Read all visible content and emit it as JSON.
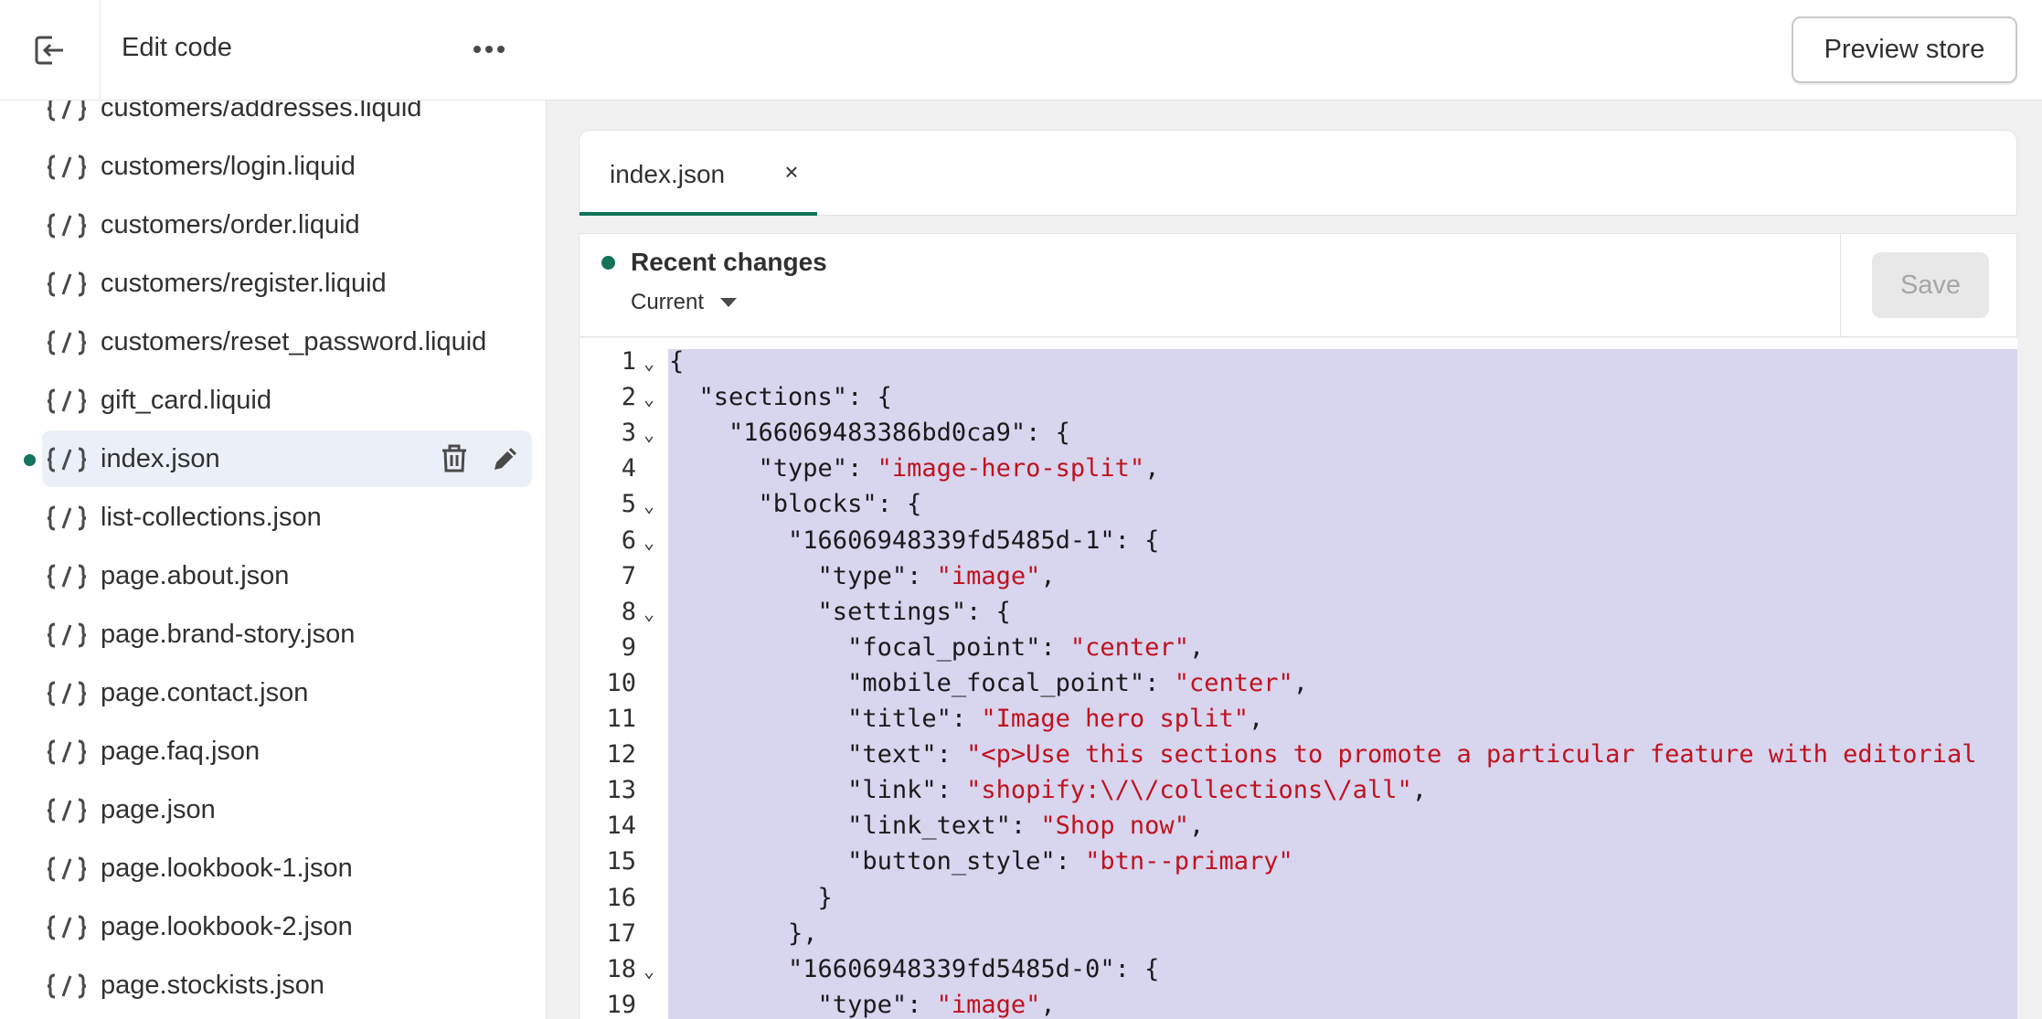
{
  "header": {
    "title": "Edit code",
    "preview_label": "Preview store",
    "exit_icon": "exit-icon",
    "more_icon": "more-horizontal-icon"
  },
  "sidebar": {
    "files": [
      {
        "name": "customers/addresses.liquid"
      },
      {
        "name": "customers/login.liquid"
      },
      {
        "name": "customers/order.liquid"
      },
      {
        "name": "customers/register.liquid"
      },
      {
        "name": "customers/reset_password.liquid"
      },
      {
        "name": "gift_card.liquid"
      },
      {
        "name": "index.json",
        "selected": true,
        "modified": true
      },
      {
        "name": "list-collections.json"
      },
      {
        "name": "page.about.json"
      },
      {
        "name": "page.brand-story.json"
      },
      {
        "name": "page.contact.json"
      },
      {
        "name": "page.faq.json"
      },
      {
        "name": "page.json"
      },
      {
        "name": "page.lookbook-1.json"
      },
      {
        "name": "page.lookbook-2.json"
      },
      {
        "name": "page.stockists.json"
      }
    ]
  },
  "editor": {
    "tab_label": "index.json",
    "tab_close": "×",
    "changes_title": "Recent changes",
    "version_selected": "Current",
    "save_label": "Save",
    "lines": [
      {
        "n": "1",
        "fold": true,
        "segments": [
          {
            "t": "{"
          }
        ]
      },
      {
        "n": "2",
        "fold": true,
        "segments": [
          {
            "t": "  \"sections\": {"
          }
        ]
      },
      {
        "n": "3",
        "fold": true,
        "segments": [
          {
            "t": "    \"166069483386bd0ca9\": {"
          }
        ]
      },
      {
        "n": "4",
        "fold": false,
        "segments": [
          {
            "t": "      \"type\": "
          },
          {
            "t": "\"image-hero-split\"",
            "s": true
          },
          {
            "t": ","
          }
        ]
      },
      {
        "n": "5",
        "fold": true,
        "segments": [
          {
            "t": "      \"blocks\": {"
          }
        ]
      },
      {
        "n": "6",
        "fold": true,
        "segments": [
          {
            "t": "        \"16606948339fd5485d-1\": {"
          }
        ]
      },
      {
        "n": "7",
        "fold": false,
        "segments": [
          {
            "t": "          \"type\": "
          },
          {
            "t": "\"image\"",
            "s": true
          },
          {
            "t": ","
          }
        ]
      },
      {
        "n": "8",
        "fold": true,
        "segments": [
          {
            "t": "          \"settings\": {"
          }
        ]
      },
      {
        "n": "9",
        "fold": false,
        "segments": [
          {
            "t": "            \"focal_point\": "
          },
          {
            "t": "\"center\"",
            "s": true
          },
          {
            "t": ","
          }
        ]
      },
      {
        "n": "10",
        "fold": false,
        "segments": [
          {
            "t": "            \"mobile_focal_point\": "
          },
          {
            "t": "\"center\"",
            "s": true
          },
          {
            "t": ","
          }
        ]
      },
      {
        "n": "11",
        "fold": false,
        "segments": [
          {
            "t": "            \"title\": "
          },
          {
            "t": "\"Image hero split\"",
            "s": true
          },
          {
            "t": ","
          }
        ]
      },
      {
        "n": "12",
        "fold": false,
        "segments": [
          {
            "t": "            \"text\": "
          },
          {
            "t": "\"<p>Use this sections to promote a particular feature with editorial",
            "s": true
          }
        ]
      },
      {
        "n": "13",
        "fold": false,
        "segments": [
          {
            "t": "            \"link\": "
          },
          {
            "t": "\"shopify:\\/\\/collections\\/all\"",
            "s": true
          },
          {
            "t": ","
          }
        ]
      },
      {
        "n": "14",
        "fold": false,
        "segments": [
          {
            "t": "            \"link_text\": "
          },
          {
            "t": "\"Shop now\"",
            "s": true
          },
          {
            "t": ","
          }
        ]
      },
      {
        "n": "15",
        "fold": false,
        "segments": [
          {
            "t": "            \"button_style\": "
          },
          {
            "t": "\"btn--primary\"",
            "s": true
          }
        ]
      },
      {
        "n": "16",
        "fold": false,
        "segments": [
          {
            "t": "          }"
          }
        ]
      },
      {
        "n": "17",
        "fold": false,
        "segments": [
          {
            "t": "        },"
          }
        ]
      },
      {
        "n": "18",
        "fold": true,
        "segments": [
          {
            "t": "        \"16606948339fd5485d-0\": {"
          }
        ]
      },
      {
        "n": "19",
        "fold": false,
        "segments": [
          {
            "t": "          \"type\": "
          },
          {
            "t": "\"image\"",
            "s": true
          },
          {
            "t": ","
          }
        ]
      }
    ]
  },
  "icons": {
    "file": "liquid-file-icon",
    "trash": "trash-icon",
    "edit": "pencil-icon",
    "fold": "chevron-down-icon"
  },
  "colors": {
    "accent": "#12735a",
    "selection": "#d8d5ef",
    "string": "#c0121d",
    "selected_row": "#ebf0f8"
  }
}
